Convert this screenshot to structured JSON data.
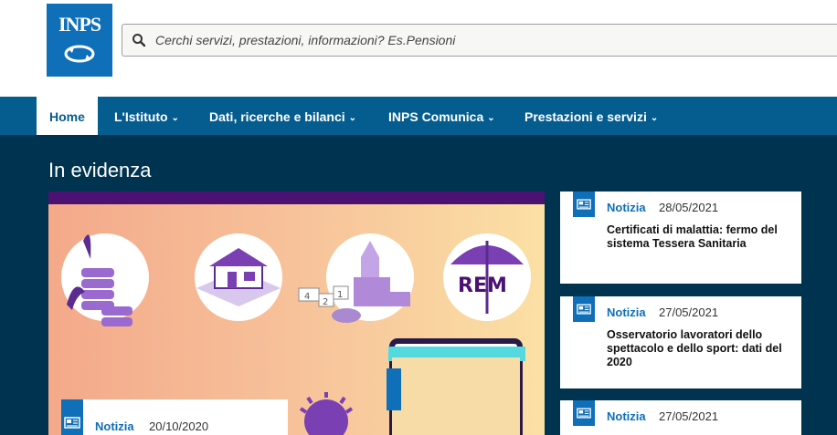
{
  "header": {
    "logo_text": "INPS",
    "search": {
      "placeholder": "Cerchi servizi, prestazioni, informazioni? Es.Pensioni",
      "value": ""
    }
  },
  "nav": {
    "items": [
      {
        "label": "Home",
        "active": true
      },
      {
        "label": "L'Istituto",
        "has_dropdown": true
      },
      {
        "label": "Dati, ricerche e bilanci",
        "has_dropdown": true
      },
      {
        "label": "INPS Comunica",
        "has_dropdown": true
      },
      {
        "label": "Prestazioni e servizi",
        "has_dropdown": true
      }
    ]
  },
  "main": {
    "section_title": "In evidenza",
    "feature": {
      "type": "Notizia",
      "date": "20/10/2020",
      "illustration_text": [
        "4",
        "2",
        "1",
        "REM"
      ]
    },
    "news": [
      {
        "type": "Notizia",
        "date": "28/05/2021",
        "title": "Certificati di malattia: fermo del sistema Tessera Sanitaria"
      },
      {
        "type": "Notizia",
        "date": "27/05/2021",
        "title": "Osservatorio lavoratori dello spettacolo e dello sport: dati del 2020"
      },
      {
        "type": "Notizia",
        "date": "27/05/2021",
        "title": ""
      }
    ]
  },
  "colors": {
    "brand_blue": "#0f6fb8",
    "nav_bg": "#055d8f",
    "main_bg": "#00334f",
    "feature_bar": "#4b1173"
  },
  "icons": [
    "search-icon",
    "chevron-down-icon",
    "newspaper-icon"
  ]
}
